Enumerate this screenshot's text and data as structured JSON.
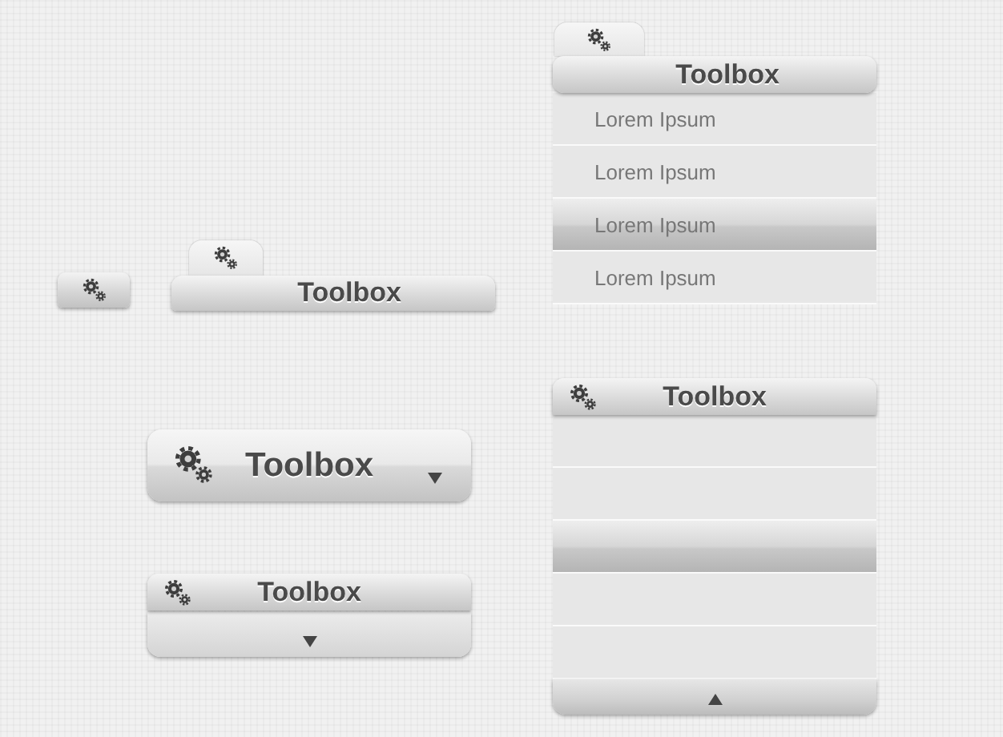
{
  "widgets": [
    {
      "kind": "gear-tab"
    },
    {
      "kind": "tab-bar",
      "title": "Toolbox"
    },
    {
      "kind": "large",
      "title": "Toolbox"
    },
    {
      "kind": "header-footer",
      "title": "Toolbox"
    },
    {
      "kind": "menu",
      "title": "Toolbox",
      "items": [
        {
          "label": "Lorem Ipsum",
          "selected": false
        },
        {
          "label": "Lorem Ipsum",
          "selected": false
        },
        {
          "label": "Lorem Ipsum",
          "selected": true
        },
        {
          "label": "Lorem Ipsum",
          "selected": false
        }
      ]
    },
    {
      "kind": "list",
      "title": "Toolbox",
      "rows": [
        {
          "selected": false
        },
        {
          "selected": false
        },
        {
          "selected": true
        },
        {
          "selected": false
        },
        {
          "selected": false
        }
      ]
    }
  ]
}
